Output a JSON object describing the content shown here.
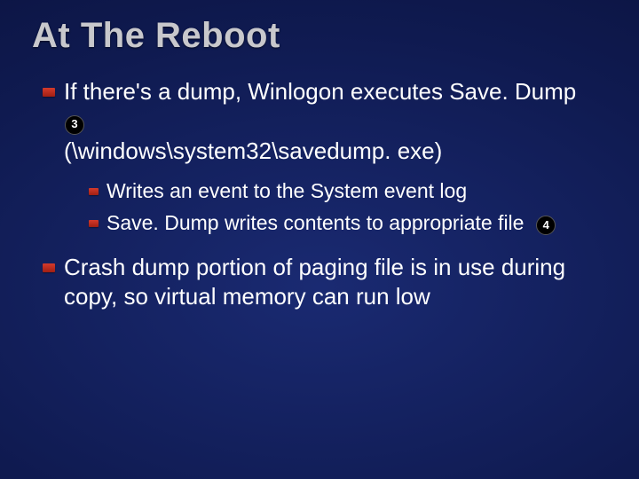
{
  "title": "At The Reboot",
  "bullets": [
    {
      "segments": [
        "If there's a dump, Winlogon executes Save. Dump ",
        "(\\windows\\system32\\savedump. exe)"
      ],
      "badge": "3",
      "badge_after_segment": 0,
      "children": [
        {
          "segments": [
            "Writes an event to the System event log"
          ]
        },
        {
          "segments": [
            "Save. Dump writes contents to appropriate file "
          ],
          "badge": "4",
          "badge_after_segment": 0
        }
      ]
    },
    {
      "segments": [
        "Crash dump portion of paging file is in use during copy, so virtual memory can run low"
      ]
    }
  ]
}
